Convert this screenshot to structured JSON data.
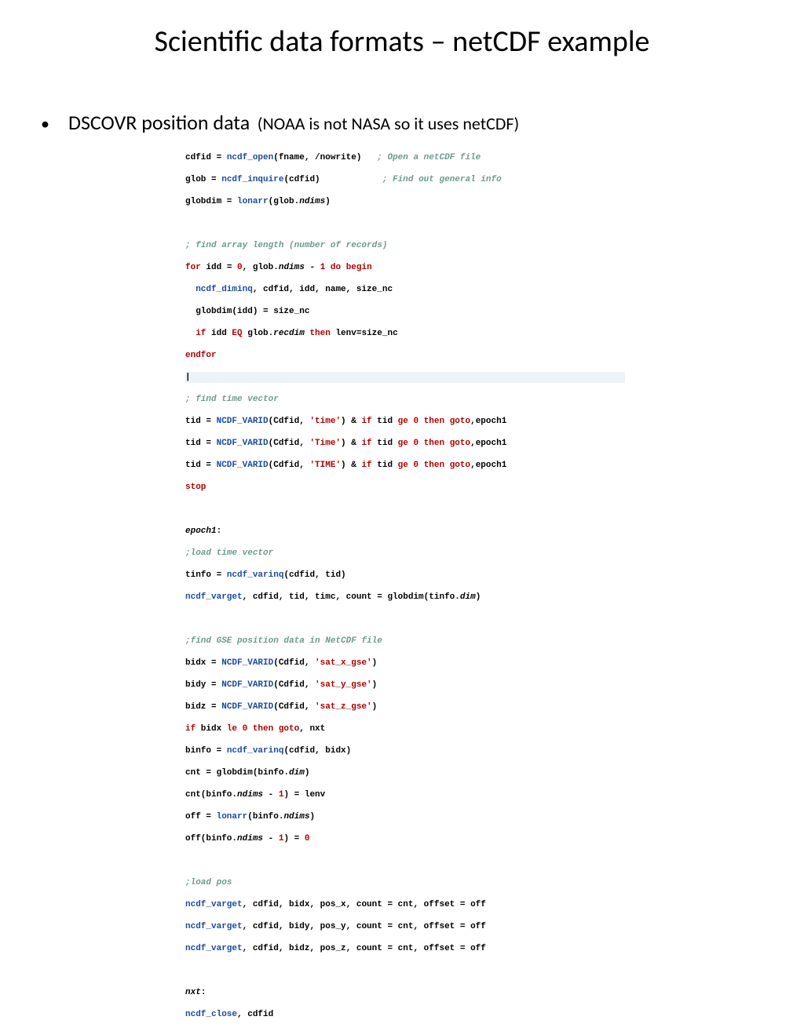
{
  "title": "Scientific data formats – netCDF example",
  "bullet": {
    "main": "DSCOVR position data",
    "sub": "(NOAA is not NASA so it uses netCDF)"
  },
  "code": {
    "l1a": "cdfid = ",
    "l1b": "ncdf_open",
    "l1c": "(fname, /nowrite)   ",
    "l1d": "; Open a netCDF file",
    "l2a": "glob = ",
    "l2b": "ncdf_inquire",
    "l2c": "(cdfid)            ",
    "l2d": "; Find out general info",
    "l3a": "globdim = ",
    "l3b": "lonarr",
    "l3c": "(glob.",
    "l3d": "ndims",
    "l3e": ")",
    "blank": " ",
    "l4": "; find array length (number of records)",
    "l5a": "for",
    "l5b": " idd = ",
    "l5c": "0",
    "l5d": ", glob.",
    "l5e": "ndims",
    "l5f": " - ",
    "l5g": "1",
    "l5h": " do begin",
    "l6a": "  ",
    "l6b": "ncdf_diminq",
    "l6c": ", cdfid, idd, name, size_nc",
    "l7": "  globdim(idd) = size_nc",
    "l8a": "  ",
    "l8b": "if",
    "l8c": " idd ",
    "l8d": "EQ",
    "l8e": " glob.",
    "l8f": "recdim",
    "l8g": " then",
    "l8h": " lenv=size_nc",
    "l9": "endfor",
    "cursor": "|",
    "l10": "; find time vector",
    "l11a": "tid = ",
    "l11b": "NCDF_VARID",
    "l11c": "(Cdfid, ",
    "l11d": "'time'",
    "l11e": ") & ",
    "l11f": "if",
    "l11g": " tid ",
    "l11h": "ge",
    "l11i": " 0 ",
    "l11j": "then",
    "l11k": " goto",
    "l11l": ",epoch1",
    "l12d": "'Time'",
    "l13d": "'TIME'",
    "l14": "stop",
    "l15": "epoch1",
    "l15b": ":",
    "l16": ";load time vector",
    "l17a": "tinfo = ",
    "l17b": "ncdf_varinq",
    "l17c": "(cdfid, tid)",
    "l18a": "ncdf_varget",
    "l18b": ", cdfid, tid, timc, count = globdim(tinfo.",
    "l18c": "dim",
    "l18d": ")",
    "l19": ";find GSE position data in NetCDF file",
    "l20a": "bidx = ",
    "l20b": "NCDF_VARID",
    "l20c": "(Cdfid, ",
    "l20d": "'sat_x_gse'",
    "l20e": ")",
    "l21d": "'sat_y_gse'",
    "l21a": "bidy = ",
    "l22d": "'sat_z_gse'",
    "l22a": "bidz = ",
    "l23a": "if",
    "l23b": " bidx ",
    "l23c": "le",
    "l23d": " 0 ",
    "l23e": "then",
    "l23f": " goto",
    "l23g": ", nxt",
    "l24a": "binfo = ",
    "l24b": "ncdf_varinq",
    "l24c": "(cdfid, bidx)",
    "l25a": "cnt = globdim(binfo.",
    "l25b": "dim",
    "l25c": ")",
    "l26a": "cnt(binfo.",
    "l26b": "ndims",
    "l26c": " - ",
    "l26d": "1",
    "l26e": ") = lenv",
    "l27a": "off = ",
    "l27b": "lonarr",
    "l27c": "(binfo.",
    "l27d": "ndims",
    "l27e": ")",
    "l28a": "off(binfo.",
    "l28b": "ndims",
    "l28c": " - ",
    "l28d": "1",
    "l28e": ") = ",
    "l28f": "0",
    "l29": ";load pos",
    "l30a": "ncdf_varget",
    "l30b": ", cdfid, bidx, pos_x, count = cnt, offset = off",
    "l31b": ", cdfid, bidy, pos_y, count = cnt, offset = off",
    "l32b": ", cdfid, bidz, pos_z, count = cnt, offset = off",
    "l33a": "nxt",
    "l33b": ":",
    "l34a": "ncdf_close",
    "l34b": ", cdfid"
  }
}
